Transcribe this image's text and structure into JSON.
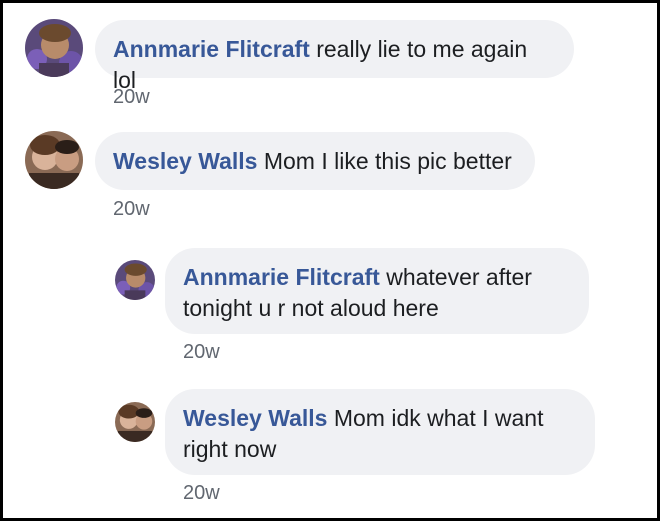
{
  "comments": [
    {
      "author": "Annmarie Flitcraft",
      "text": "really lie to me again lol",
      "time": "20w"
    },
    {
      "author": "Wesley Walls",
      "text": "Mom I like this pic better",
      "time": "20w"
    }
  ],
  "replies": [
    {
      "author": "Annmarie Flitcraft",
      "text": "whatever after tonight u r not aloud here",
      "time": "20w"
    },
    {
      "author": "Wesley Walls",
      "text": "Mom idk what I want right now",
      "time": "20w"
    }
  ]
}
